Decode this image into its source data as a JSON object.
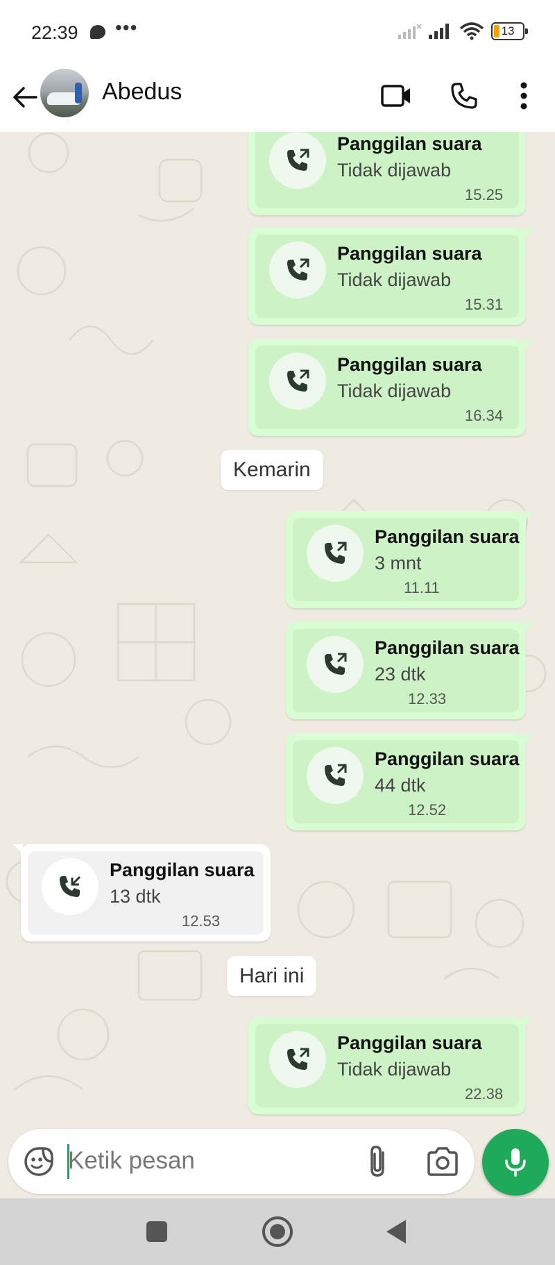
{
  "status_bar": {
    "time": "22:39",
    "more_icon": "•••",
    "battery_level": "13"
  },
  "header": {
    "contact_name": "Abedus",
    "icons": [
      "back-arrow-icon",
      "video-call-icon",
      "voice-call-icon",
      "more-vert-icon"
    ]
  },
  "messages": [
    {
      "type": "call",
      "direction": "outgoing",
      "title": "Panggilan suara",
      "detail": "Tidak dijawab",
      "time": "15.25"
    },
    {
      "type": "call",
      "direction": "outgoing",
      "title": "Panggilan suara",
      "detail": "Tidak dijawab",
      "time": "15.31"
    },
    {
      "type": "call",
      "direction": "outgoing",
      "title": "Panggilan suara",
      "detail": "Tidak dijawab",
      "time": "16.34"
    },
    {
      "type": "date",
      "label": "Kemarin"
    },
    {
      "type": "call",
      "direction": "outgoing",
      "title": "Panggilan suara",
      "detail": "3 mnt",
      "time": "11.11"
    },
    {
      "type": "call",
      "direction": "outgoing",
      "title": "Panggilan suara",
      "detail": "23 dtk",
      "time": "12.33"
    },
    {
      "type": "call",
      "direction": "outgoing",
      "title": "Panggilan suara",
      "detail": "44 dtk",
      "time": "12.52"
    },
    {
      "type": "call",
      "direction": "incoming",
      "title": "Panggilan suara",
      "detail": "13 dtk",
      "time": "12.53"
    },
    {
      "type": "date",
      "label": "Hari ini"
    },
    {
      "type": "call",
      "direction": "outgoing",
      "title": "Panggilan suara",
      "detail": "Tidak dijawab",
      "time": "22.38"
    }
  ],
  "composer": {
    "placeholder": "Ketik pesan",
    "icons": [
      "emoji-icon",
      "attach-icon",
      "camera-icon",
      "mic-icon"
    ]
  },
  "colors": {
    "outgoing_bubble": "#d8fdd2",
    "chat_background": "#efeae2",
    "accent": "#1faa59"
  }
}
